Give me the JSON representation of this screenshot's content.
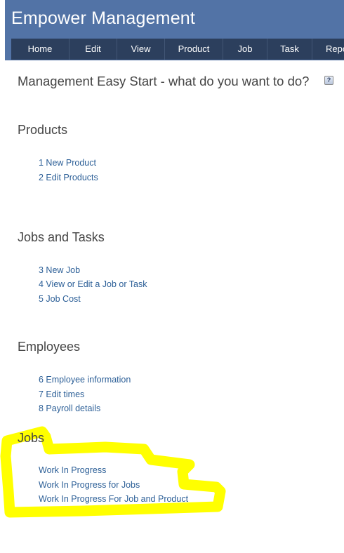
{
  "header": {
    "title": "Empower Management",
    "background_color": "#5273a6",
    "nav_color": "#2c3f5d"
  },
  "nav": {
    "home": "Home",
    "edit": "Edit",
    "view": "View",
    "product": "Product",
    "job": "Job",
    "task": "Task",
    "report": "Report"
  },
  "main": {
    "title": "Management Easy Start - what do you want to do?",
    "help_icon": "help-icon",
    "sections": [
      {
        "title": "Products",
        "links": [
          "1 New Product",
          "2 Edit Products"
        ]
      },
      {
        "title": "Jobs and Tasks",
        "links": [
          "3 New Job",
          "4 View or Edit a Job or Task",
          "5 Job Cost"
        ]
      },
      {
        "title": "Employees",
        "links": [
          "6 Employee information",
          "7 Edit times",
          "8 Payroll details"
        ]
      },
      {
        "title": "Jobs",
        "links": [
          "Work In Progress",
          "Work In Progress for Jobs",
          "Work In Progress For Job and Product"
        ]
      }
    ]
  },
  "annotation": {
    "highlight_color": "#ffff00"
  }
}
